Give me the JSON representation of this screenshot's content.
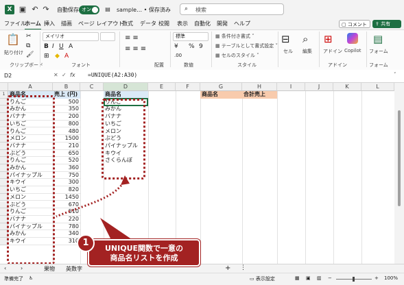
{
  "titlebar": {
    "logo": "X",
    "autosave_label": "自動保存",
    "autosave_state": "オン",
    "doc_title": "sample… • 保存済み",
    "search_placeholder": "検索"
  },
  "menu": [
    "ファイル",
    "ホーム",
    "挿入",
    "描画",
    "ページ レイアウト",
    "数式",
    "データ",
    "校閲",
    "表示",
    "自動化",
    "開発",
    "ヘルプ"
  ],
  "menu_active": "ホーム",
  "comment_button": "コメント",
  "share_button": "共有",
  "ribbon": {
    "paste": "貼り付け",
    "clipboard": "クリップボード",
    "font_name": "メイリオ",
    "font_group": "フォント",
    "align_group": "配置",
    "number_format": "標準",
    "number_group": "数値",
    "cond_format": "条件付き書式",
    "table_format": "テーブルとして書式設定",
    "cell_styles": "セルのスタイル",
    "style_group": "スタイル",
    "cells": "セル",
    "editing": "編集",
    "addin": "アドイン",
    "copilot": "Copilot",
    "form": "フォーム",
    "addin_group": "アドイン",
    "form_group": "フォーム"
  },
  "formula": {
    "name_box": "D2",
    "fx": "fx",
    "text": "=UNIQUE(A2:A30)"
  },
  "columns": [
    "A",
    "B",
    "C",
    "D",
    "E",
    "F",
    "G",
    "H",
    "I",
    "J",
    "K",
    "L"
  ],
  "table": {
    "header_name": "商品名",
    "header_sales": "売上 (円)",
    "rows": [
      [
        "りんご",
        "500"
      ],
      [
        "みかん",
        "350"
      ],
      [
        "バナナ",
        "200"
      ],
      [
        "いちご",
        "800"
      ],
      [
        "りんご",
        "480"
      ],
      [
        "メロン",
        "1500"
      ],
      [
        "バナナ",
        "210"
      ],
      [
        "ぶどう",
        "650"
      ],
      [
        "りんご",
        "520"
      ],
      [
        "みかん",
        "360"
      ],
      [
        "パイナップル",
        "750"
      ],
      [
        "キウイ",
        "300"
      ],
      [
        "いちご",
        "820"
      ],
      [
        "メロン",
        "1450"
      ],
      [
        "ぶどう",
        "670"
      ],
      [
        "りんご",
        "510"
      ],
      [
        "バナナ",
        "220"
      ],
      [
        "パイナップル",
        "780"
      ],
      [
        "みかん",
        "340"
      ],
      [
        "キウイ",
        "310"
      ]
    ]
  },
  "unique": {
    "header": "商品名",
    "values": [
      "りんご",
      "みかん",
      "バナナ",
      "いちご",
      "メロン",
      "ぶどう",
      "パイナップル",
      "キウイ",
      "さくらんぼ"
    ]
  },
  "summary": {
    "header_g": "商品名",
    "header_h": "合計売上"
  },
  "sheet_tabs": [
    "果物",
    "英数字"
  ],
  "status": {
    "ready": "準備完了",
    "display_settings": "表示設定",
    "zoom": "100%"
  },
  "callout": {
    "number": "1",
    "line1": "UNIQUE関数で一意の",
    "line2": "商品名リストを作成"
  },
  "colors": {
    "accent": "#1d6f42",
    "annotation": "#a32222",
    "header_blue": "#dbeaf7",
    "header_orange": "#f8cbad"
  }
}
